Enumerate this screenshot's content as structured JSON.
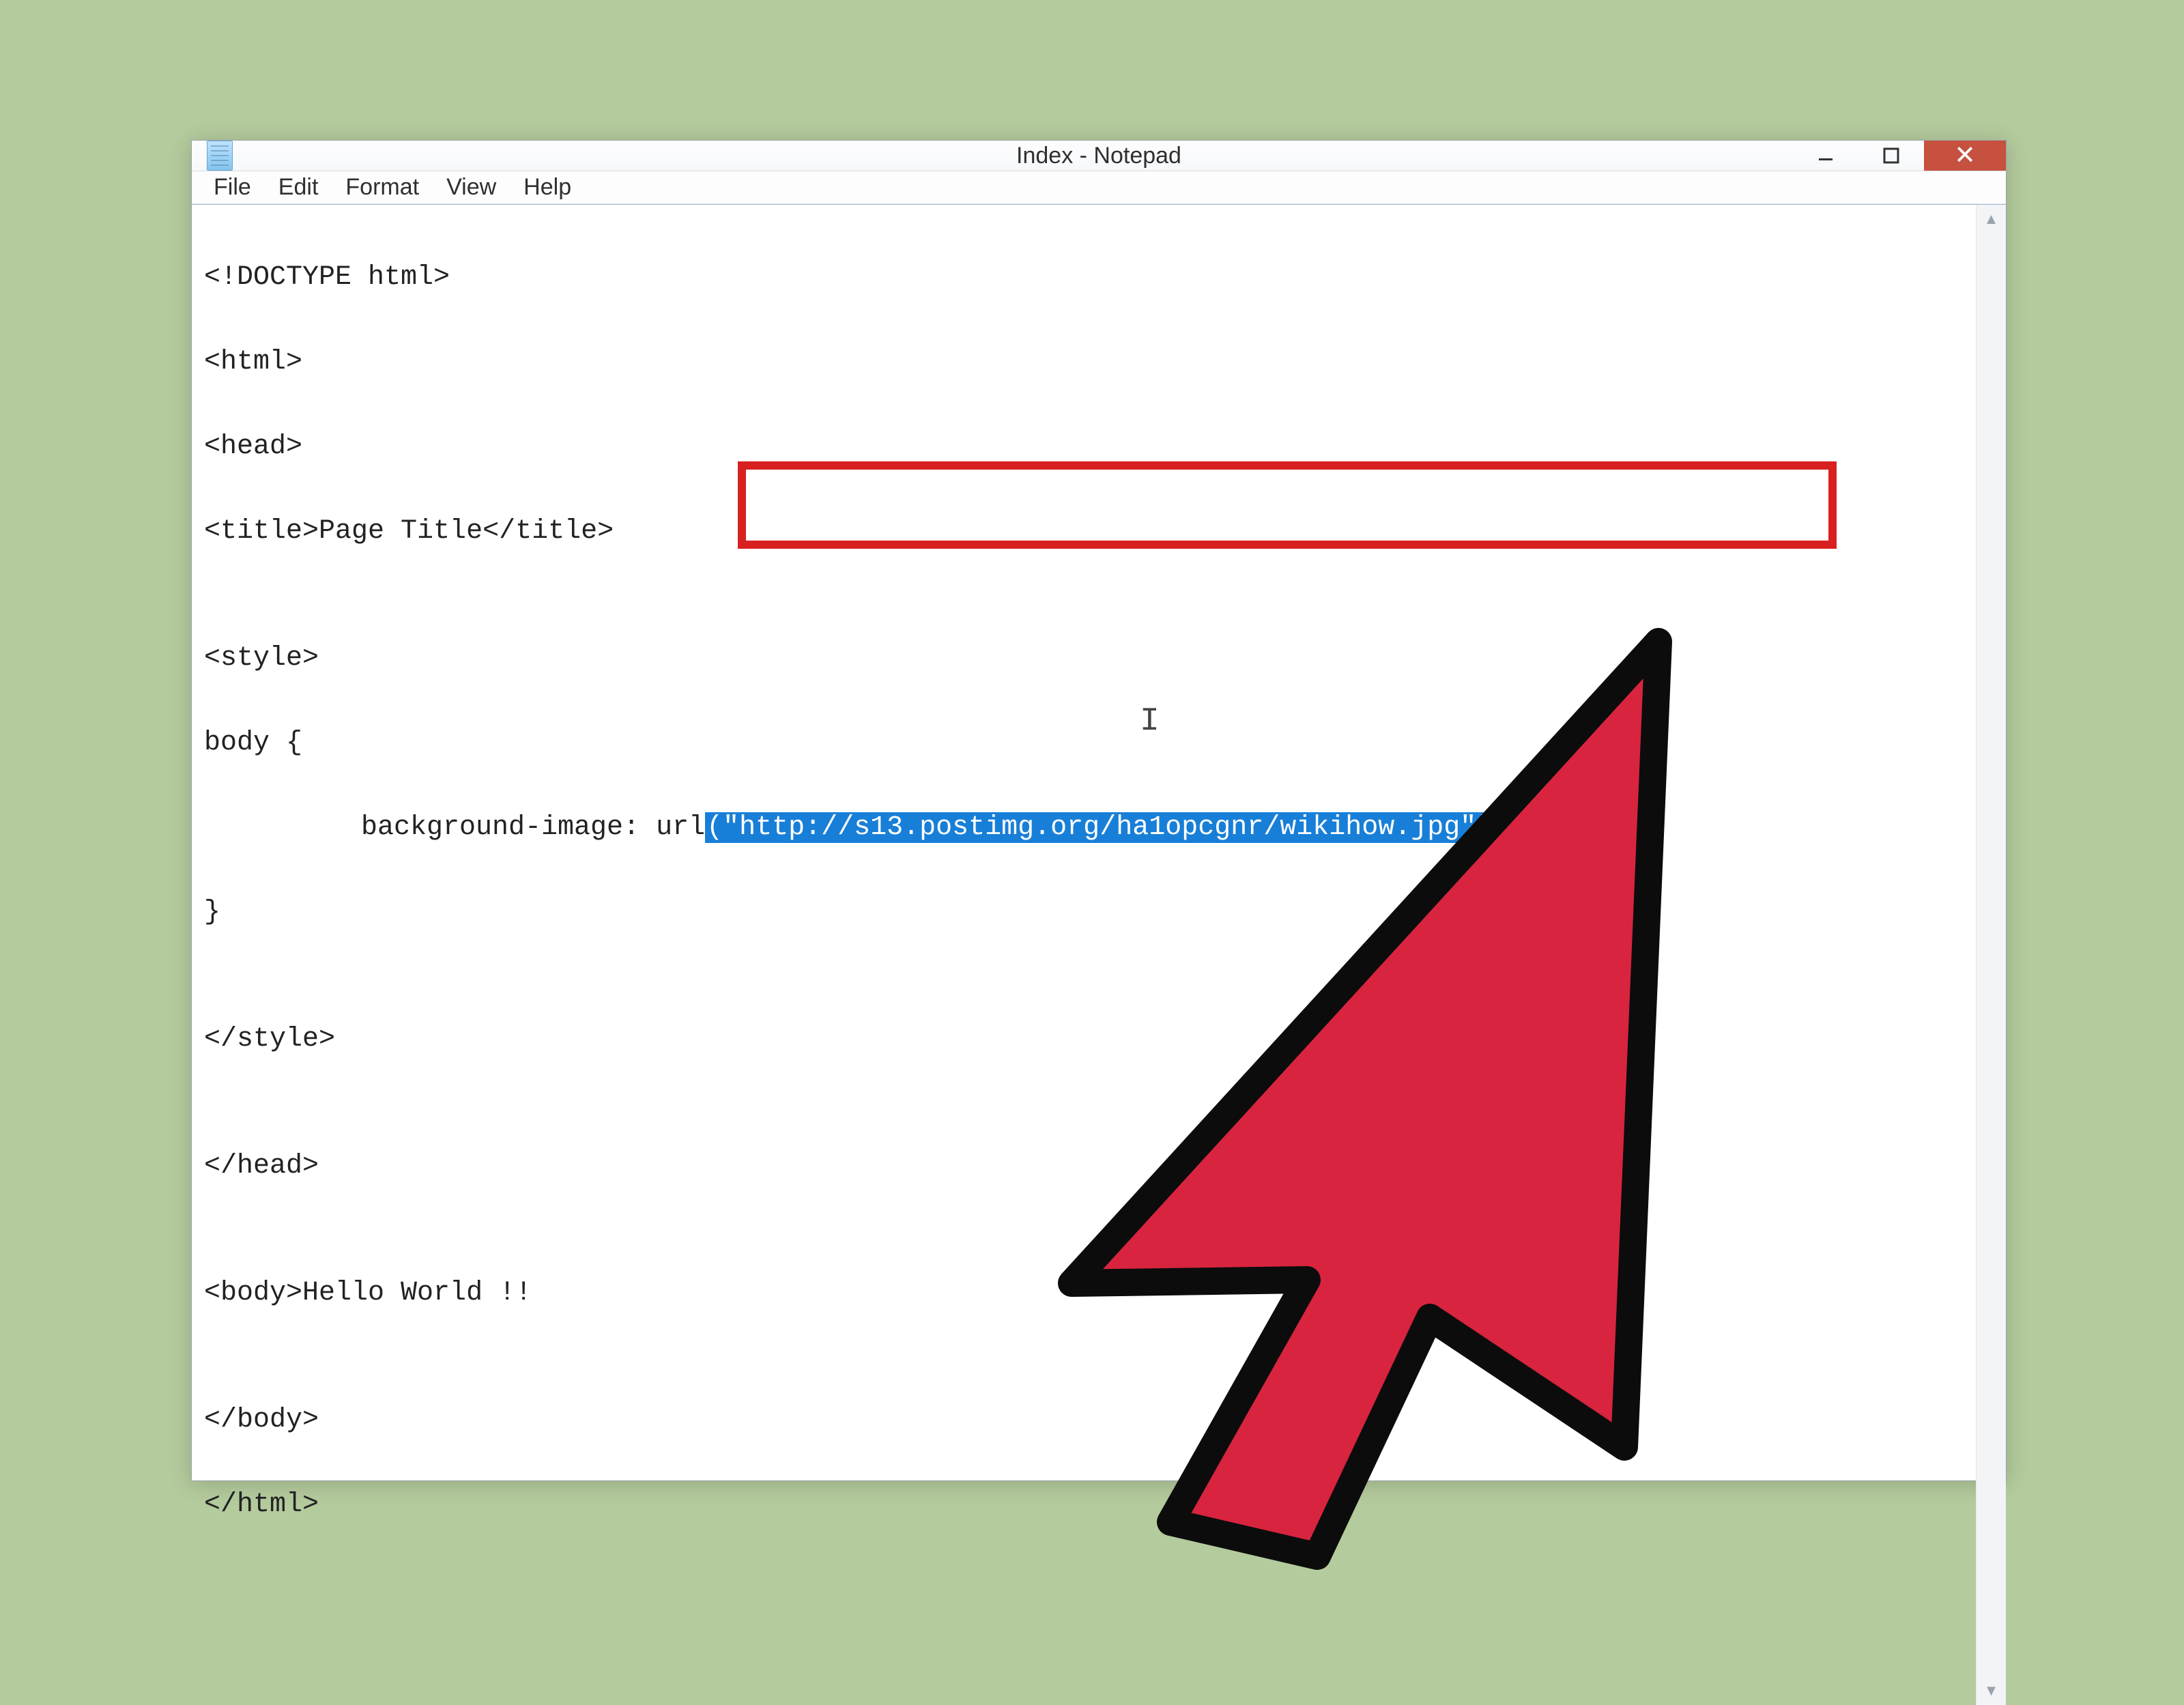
{
  "window": {
    "title": "Index - Notepad"
  },
  "menu": {
    "file": "File",
    "edit": "Edit",
    "format": "Format",
    "view": "View",
    "help": "Help"
  },
  "code": {
    "l1": "<!DOCTYPE html>",
    "l2": "<html>",
    "l3": "<head>",
    "l4": "<title>Page Title</title>",
    "l5": "",
    "l6": "<style>",
    "l7": "body {",
    "l8a": "background-image: url",
    "l8_sel": "(\"http://s13.postimg.org/ha1opcgnr/wikihow.jpg\");",
    "l9": "}",
    "l10": "",
    "l11": "</style>",
    "l12": "",
    "l13": "</head>",
    "l14": "",
    "l15": "<body>Hello World !!",
    "l16": "",
    "l17": "</body>",
    "l18": "</html>"
  },
  "annotations": {
    "highlight_color": "#d92020",
    "selection_bg": "#187fd8",
    "page_bg": "#b4cb9d"
  }
}
